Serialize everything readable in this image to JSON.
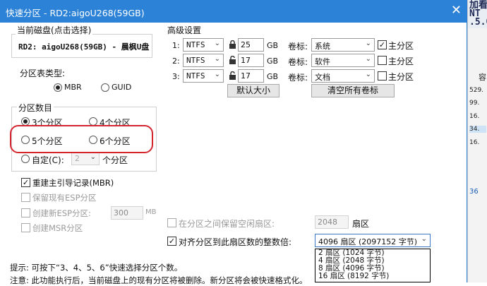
{
  "window": {
    "title": "快速分区 - RD2:aigoU268(59GB)",
    "close_glyph": "✕"
  },
  "disk": {
    "label": "当前磁盘(点击选择)",
    "selected": "RD2: aigoU268(59GB) - 晨枫U盘"
  },
  "partition_table": {
    "label": "分区表类型:",
    "options": [
      "MBR",
      "GUID"
    ],
    "selected": "MBR"
  },
  "partition_count": {
    "label": "分区数目",
    "options": [
      "3个分区",
      "4个分区",
      "5个分区",
      "6个分区"
    ],
    "selected": "3个分区",
    "custom_label": "自定(C):",
    "custom_value": "2",
    "custom_suffix": "个分区"
  },
  "options": {
    "rebuild_mbr": "重建主引导记录(MBR)",
    "keep_esp": "保留现有ESP分区",
    "create_esp": "创建新ESP分区:",
    "esp_size": "300",
    "esp_unit": "MB",
    "create_msr": "创建MSR分区"
  },
  "advanced": {
    "label": "高级设置",
    "rows": [
      {
        "index": "1:",
        "fs": "NTFS",
        "size": "25",
        "unit": "GB",
        "vol_label": "卷标:",
        "vol_value": "系统",
        "primary_label": "主分区",
        "primary": true
      },
      {
        "index": "2:",
        "fs": "NTFS",
        "size": "17",
        "unit": "GB",
        "vol_label": "卷标:",
        "vol_value": "软件",
        "primary_label": "主分区",
        "primary": false
      },
      {
        "index": "3:",
        "fs": "NTFS",
        "size": "17",
        "unit": "GB",
        "vol_label": "卷标:",
        "vol_value": "文档",
        "primary_label": "主分区",
        "primary": false
      }
    ],
    "default_size_button": "默认大小",
    "clear_labels_button": "清空所有卷标"
  },
  "alignment": {
    "reserve_label": "在分区之间保留空闲扇区:",
    "reserve_value": "2048",
    "reserve_unit": "扇区",
    "align_label": "对齐分区到此扇区数的整数倍:",
    "align_value": "4096 扇区 (2097152 字节)",
    "dropdown_options": [
      "2 扇区  (1024 字节)",
      "4 扇区  (2048 字节)",
      "8 扇区  (4096 字节)",
      "16 扇区  (8192 字节)"
    ]
  },
  "hints": {
    "tip": "提示: 可按下“3、4、5、6”快速选择分区个数。",
    "note": "注意: 此功能执行后，当前磁盘上的现有分区将被删除。新分区将会被快速格式化。"
  },
  "background_app": {
    "header": "加看 NT .5.0",
    "col_char": "容",
    "values": [
      "529.",
      "99.",
      "16.",
      "34.",
      "16.",
      "36"
    ]
  },
  "colors": {
    "titlebar": "#2c82d6",
    "highlight_ring": "#d4252f"
  }
}
